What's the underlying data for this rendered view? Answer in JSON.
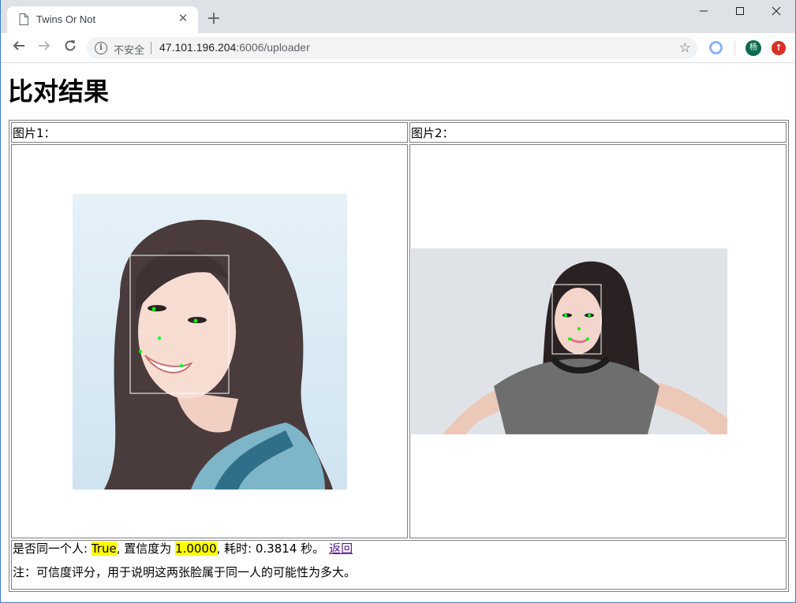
{
  "browser": {
    "tab_title": "Twins Or Not",
    "insecure_label": "不安全",
    "url_host": "47.101.196.204",
    "url_rest": ":6006/uploader",
    "avatar_letter": "杨"
  },
  "page": {
    "heading": "比对结果",
    "image1_label": "图片1：",
    "image2_label": "图片2：",
    "result": {
      "prefix": "是否同一个人: ",
      "same_person": "True",
      "confidence_prefix": ", 置信度为 ",
      "confidence": "1.0000",
      "time_prefix": ", 耗时: ",
      "time": "0.3814",
      "time_suffix": " 秒。",
      "back_link": "返回"
    },
    "note": "注：可信度评分，用于说明这两张脸属于同一人的可能性为多大。"
  },
  "colors": {
    "highlight": "#ffff00",
    "link_visited": "#551a8b",
    "face_box": "#ffffff",
    "landmark": "#00ff00"
  }
}
